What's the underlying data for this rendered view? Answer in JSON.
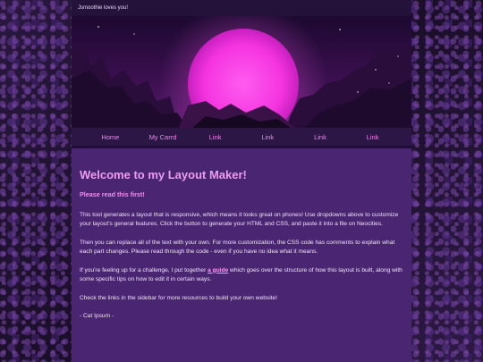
{
  "topbar": {
    "text": "Jsmoothie loves you!"
  },
  "header": {
    "image_icon": "synthwave-sunset-mountains-image"
  },
  "nav": {
    "items": [
      {
        "label": "Home"
      },
      {
        "label": "My Carrd"
      },
      {
        "label": "Link"
      },
      {
        "label": "Link"
      },
      {
        "label": "Link"
      },
      {
        "label": "Link"
      }
    ]
  },
  "content": {
    "title": "Welcome to my Layout Maker!",
    "subtitle": "Please read this first!",
    "p1": "This tool generates a layout that is responsive, which means it looks great on phones! Use dropdowns above to customize your layout's general features. Click the button to generate your HTML and CSS, and paste it into a file on Neocities.",
    "p2": "Then you can replace all of the text with your own. For more customization, the CSS code has comments to explain what each part changes. Please read through the code - even if you have no idea what it means.",
    "p3_before": "If you're feeling up for a challenge, I put together ",
    "p3_link": "a guide",
    "p3_after": " which goes over the structure of how this layout is built, along with some specific tips on how to edit it in certain ways.",
    "p4": "Check the links in the sidebar for more resources to build your own website!",
    "signature": "- Cat Ipsum -"
  },
  "colors": {
    "page_bg": "#1b0f2a",
    "container_bg": "#4a2571",
    "nav_bg": "#2c1646",
    "accent_pink": "#ee86ea",
    "heading_pink": "#ef9cef"
  }
}
